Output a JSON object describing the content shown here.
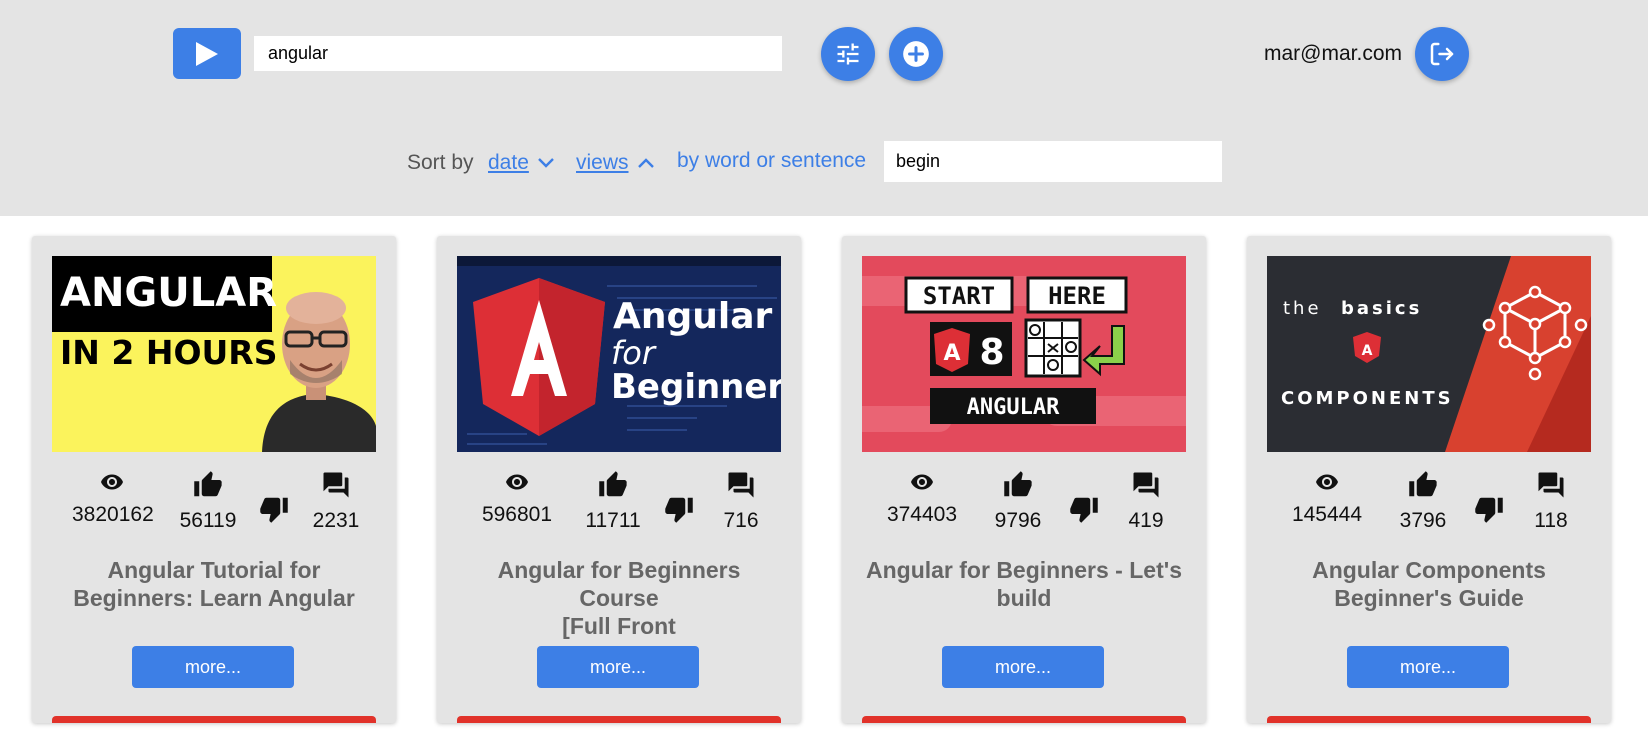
{
  "header": {
    "search_value": "angular",
    "user_email": "mar@mar.com"
  },
  "sort": {
    "label": "Sort by",
    "date_label": "date",
    "views_label": "views",
    "word_label": "by word or sentence",
    "word_value": "begin"
  },
  "colors": {
    "accent": "#3d7fe6",
    "header_bg": "#e4e4e4",
    "progress": "#e1322a"
  },
  "icons": {
    "logo": "play-icon",
    "filter": "tune-icon",
    "add": "add-circle-icon",
    "logout": "logout-icon",
    "views": "eye-icon",
    "likes": "thumb-up-icon",
    "dislikes": "thumb-down-icon",
    "comments": "comments-icon"
  },
  "cards": [
    {
      "views": "3820162",
      "likes": "56119",
      "comments": "2231",
      "title_line1": "Angular Tutorial for",
      "title_line2": "Beginners: Learn Angular",
      "more_label": "more...",
      "thumb_text1": "ANGULAR",
      "thumb_text2": "IN 2 HOURS"
    },
    {
      "views": "596801",
      "likes": "11711",
      "comments": "716",
      "title_line1": "Angular for Beginners Course",
      "title_line2": "[Full Front",
      "more_label": "more...",
      "thumb_text1": "Angular",
      "thumb_text2": "for",
      "thumb_text3": "Beginners"
    },
    {
      "views": "374403",
      "likes": "9796",
      "comments": "419",
      "title_line1": "Angular for Beginners - Let's",
      "title_line2": "build",
      "more_label": "more...",
      "thumb_text1": "START",
      "thumb_text2": "HERE",
      "thumb_text3": "8",
      "thumb_text4": "ANGULAR"
    },
    {
      "views": "145444",
      "likes": "3796",
      "comments": "118",
      "title_line1": "Angular Components",
      "title_line2": "Beginner's Guide",
      "more_label": "more...",
      "thumb_text1": "the",
      "thumb_text2": "basics",
      "thumb_text3": "COMPONENTS"
    }
  ]
}
